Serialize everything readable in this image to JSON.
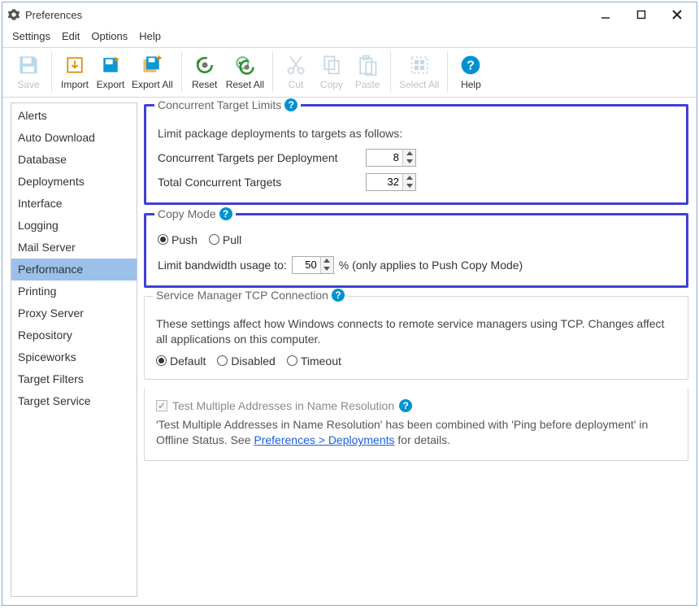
{
  "window": {
    "title": "Preferences"
  },
  "menu": {
    "settings": "Settings",
    "edit": "Edit",
    "options": "Options",
    "help": "Help"
  },
  "toolbar": {
    "save": "Save",
    "import": "Import",
    "export": "Export",
    "export_all": "Export All",
    "reset": "Reset",
    "reset_all": "Reset All",
    "cut": "Cut",
    "copy": "Copy",
    "paste": "Paste",
    "select_all": "Select All",
    "help": "Help"
  },
  "sidebar": {
    "items": [
      "Alerts",
      "Auto Download",
      "Database",
      "Deployments",
      "Interface",
      "Logging",
      "Mail Server",
      "Performance",
      "Printing",
      "Proxy Server",
      "Repository",
      "Spiceworks",
      "Target Filters",
      "Target Service"
    ],
    "selected_index": 7
  },
  "panel": {
    "limits": {
      "legend": "Concurrent Target Limits",
      "desc": "Limit package deployments to targets as follows:",
      "per_deployment_label": "Concurrent Targets per Deployment",
      "per_deployment_value": "8",
      "total_label": "Total Concurrent Targets",
      "total_value": "32"
    },
    "copy_mode": {
      "legend": "Copy Mode",
      "push": "Push",
      "pull": "Pull",
      "selected": "push",
      "limit_label_prefix": "Limit bandwidth usage to:",
      "limit_value": "50",
      "limit_label_suffix": "% (only applies to Push Copy Mode)"
    },
    "svc": {
      "legend": "Service Manager TCP Connection",
      "desc": "These settings affect how Windows connects to remote service managers using TCP. Changes affect all applications on this computer.",
      "default": "Default",
      "disabled": "Disabled",
      "timeout": "Timeout",
      "selected": "default"
    },
    "name_res": {
      "check_label": "Test Multiple Addresses in Name Resolution",
      "note_prefix": "'Test Multiple Addresses in Name Resolution' has been combined with 'Ping before deployment' in Offline Status. See ",
      "note_link": "Preferences > Deployments",
      "note_suffix": " for details."
    }
  },
  "colors": {
    "highlight_border": "#3f3fd9",
    "accent": "#0092d0",
    "selection": "#9bc1ea"
  }
}
